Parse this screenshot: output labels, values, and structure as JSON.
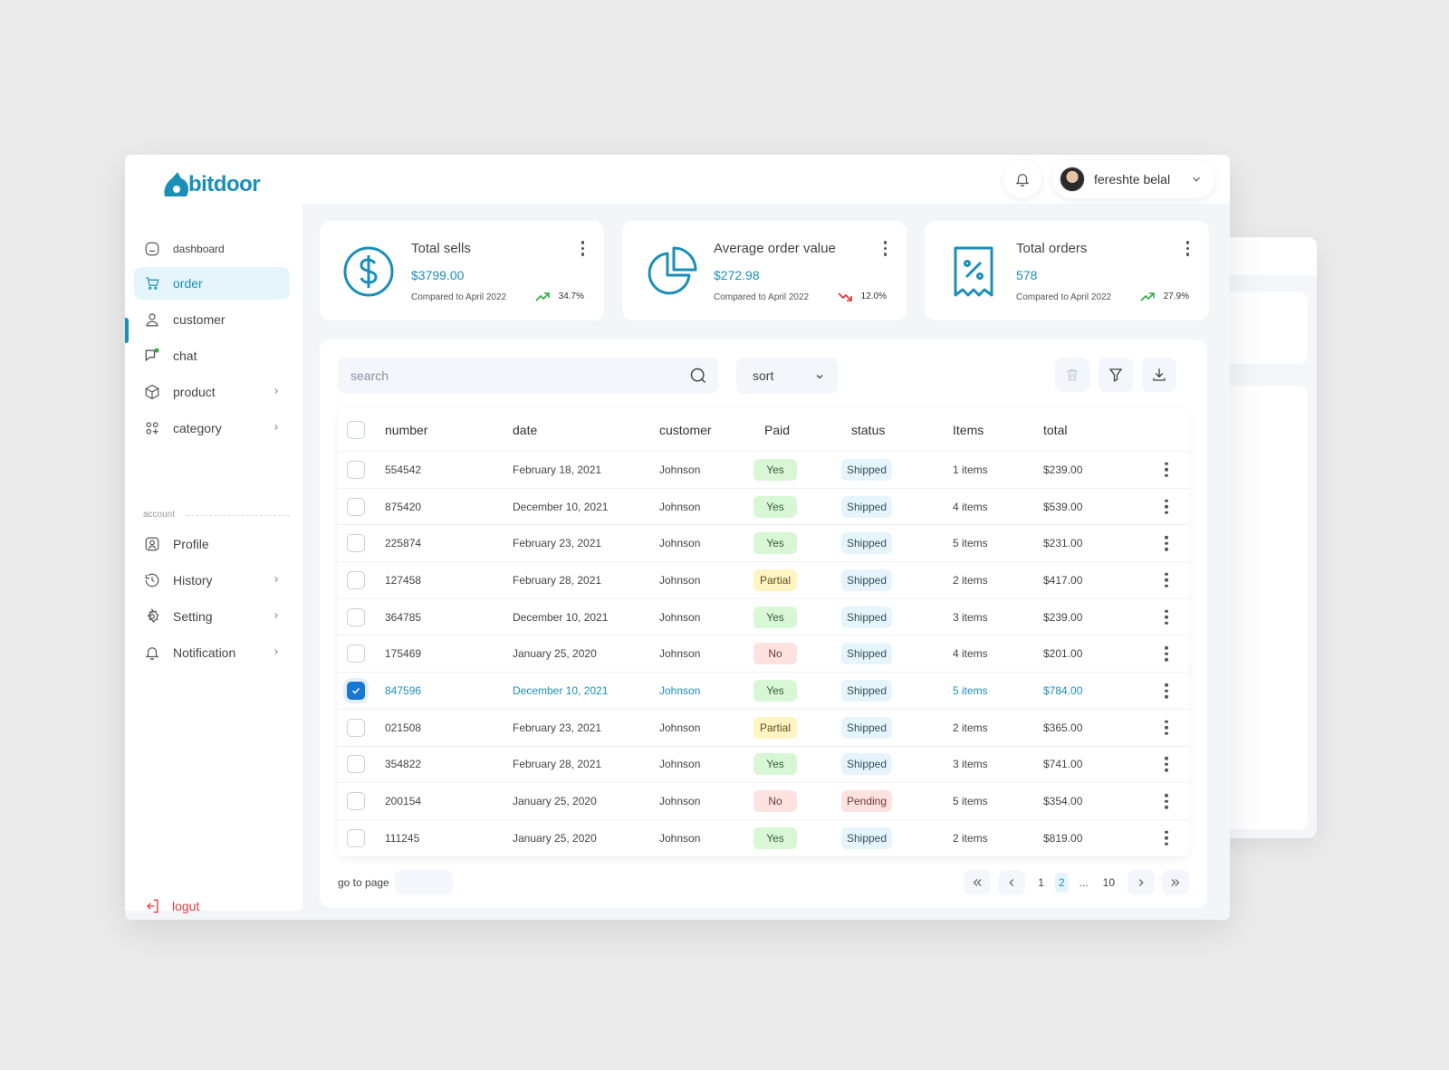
{
  "brand": {
    "name": "bitdoor",
    "color": "#1a8fb8"
  },
  "user": {
    "name": "fereshte belal"
  },
  "sidebar": {
    "items": [
      {
        "label": "dashboard",
        "icon": "dashboard-icon"
      },
      {
        "label": "order",
        "icon": "cart-icon",
        "active": true
      },
      {
        "label": "customer",
        "icon": "user-icon"
      },
      {
        "label": "chat",
        "icon": "chat-icon"
      },
      {
        "label": "product",
        "icon": "box-icon"
      },
      {
        "label": "category",
        "icon": "grid-icon"
      }
    ],
    "section_label": "account",
    "account_items": [
      {
        "label": "Profile",
        "icon": "profile-icon"
      },
      {
        "label": "History",
        "icon": "history-icon"
      },
      {
        "label": "Setting",
        "icon": "gear-icon"
      },
      {
        "label": "Notification",
        "icon": "bell-icon"
      }
    ],
    "logout_label": "logut"
  },
  "cards": [
    {
      "title": "Total sells",
      "value": "$3799.00",
      "compare": "Compared to April 2022",
      "trend": "34.7%",
      "direction": "up"
    },
    {
      "title": "Average order value",
      "value": "$272.98",
      "compare": "Compared to April 2022",
      "trend": "12.0%",
      "direction": "down"
    },
    {
      "title": "Total orders",
      "value": "578",
      "compare": "Compared to April 2022",
      "trend": "27.9%",
      "direction": "up"
    }
  ],
  "toolbar": {
    "search_placeholder": "search",
    "sort_label": "sort"
  },
  "table": {
    "columns": [
      "number",
      "date",
      "customer",
      "Paid",
      "status",
      "Items",
      "total"
    ],
    "rows": [
      {
        "number": "554542",
        "date": "February 18, 2021",
        "customer": "Johnson",
        "paid": "Yes",
        "status": "Shipped",
        "items": "1 items",
        "total": "$239.00",
        "checked": false
      },
      {
        "number": "875420",
        "date": "December 10, 2021",
        "customer": "Johnson",
        "paid": "Yes",
        "status": "Shipped",
        "items": "4 items",
        "total": "$539.00",
        "checked": false
      },
      {
        "number": "225874",
        "date": "February 23, 2021",
        "customer": "Johnson",
        "paid": "Yes",
        "status": "Shipped",
        "items": "5 items",
        "total": "$231.00",
        "checked": false
      },
      {
        "number": "127458",
        "date": "February 28, 2021",
        "customer": "Johnson",
        "paid": "Partial",
        "status": "Shipped",
        "items": "2 items",
        "total": "$417.00",
        "checked": false
      },
      {
        "number": "364785",
        "date": "December 10, 2021",
        "customer": "Johnson",
        "paid": "Yes",
        "status": "Shipped",
        "items": "3 items",
        "total": "$239.00",
        "checked": false
      },
      {
        "number": "175469",
        "date": "January 25, 2020",
        "customer": "Johnson",
        "paid": "No",
        "status": "Shipped",
        "items": "4 items",
        "total": "$201.00",
        "checked": false
      },
      {
        "number": "847596",
        "date": "December 10, 2021",
        "customer": "Johnson",
        "paid": "Yes",
        "status": "Shipped",
        "items": "5 items",
        "total": "$784.00",
        "checked": true
      },
      {
        "number": "021508",
        "date": "February 23, 2021",
        "customer": "Johnson",
        "paid": "Partial",
        "status": "Shipped",
        "items": "2 items",
        "total": "$365.00",
        "checked": false
      },
      {
        "number": "354822",
        "date": "February 28, 2021",
        "customer": "Johnson",
        "paid": "Yes",
        "status": "Shipped",
        "items": "3 items",
        "total": "$741.00",
        "checked": false
      },
      {
        "number": "200154",
        "date": "January 25, 2020",
        "customer": "Johnson",
        "paid": "No",
        "status": "Pending",
        "items": "5 items",
        "total": "$354.00",
        "checked": false
      },
      {
        "number": "111245",
        "date": "January 25, 2020",
        "customer": "Johnson",
        "paid": "Yes",
        "status": "Shipped",
        "items": "2 items",
        "total": "$819.00",
        "checked": false
      }
    ]
  },
  "pagination": {
    "goto_label": "go to page",
    "pages": [
      "1",
      "2",
      "...",
      "10"
    ],
    "current": "2"
  },
  "colors": {
    "accent": "#1a8fb8",
    "up": "#2eaa3a",
    "down": "#d9332b",
    "logout": "#e83a3a"
  }
}
